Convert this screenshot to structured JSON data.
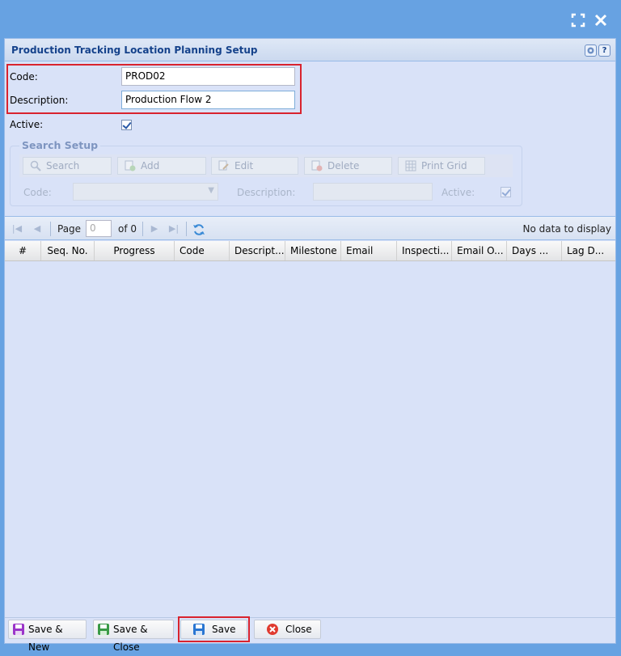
{
  "window": {
    "maximize_icon": "maximize-icon",
    "close_icon": "close-icon"
  },
  "panel": {
    "title": "Production Tracking Location Planning Setup",
    "tools": [
      "gear-icon",
      "help-icon"
    ],
    "help_glyph": "?"
  },
  "form": {
    "code_label": "Code:",
    "code_value": "PROD02",
    "description_label": "Description:",
    "description_value": "Production Flow 2",
    "active_label": "Active:",
    "active_checked": true
  },
  "search_setup": {
    "legend": "Search Setup",
    "buttons": [
      "Search",
      "Add",
      "Edit",
      "Delete",
      "Print Grid"
    ],
    "code_label": "Code:",
    "description_label": "Description:",
    "active_label": "Active:"
  },
  "paging": {
    "page_label": "Page",
    "page_value": "0",
    "of_label": "of 0",
    "empty_text": "No data to display"
  },
  "grid": {
    "columns": [
      "#",
      "Seq. No.",
      "Progress",
      "Code",
      "Descript...",
      "Milestone",
      "Email",
      "Inspecti...",
      "Email O...",
      "Days ...",
      "Lag D..."
    ]
  },
  "footer": {
    "buttons": [
      "Save & New",
      "Save & Close",
      "Save",
      "Close"
    ]
  },
  "colors": {
    "window_bg": "#67a2e2",
    "panel_bg": "#d9e2f8",
    "title_color": "#15428b",
    "highlight": "#d9232e"
  }
}
